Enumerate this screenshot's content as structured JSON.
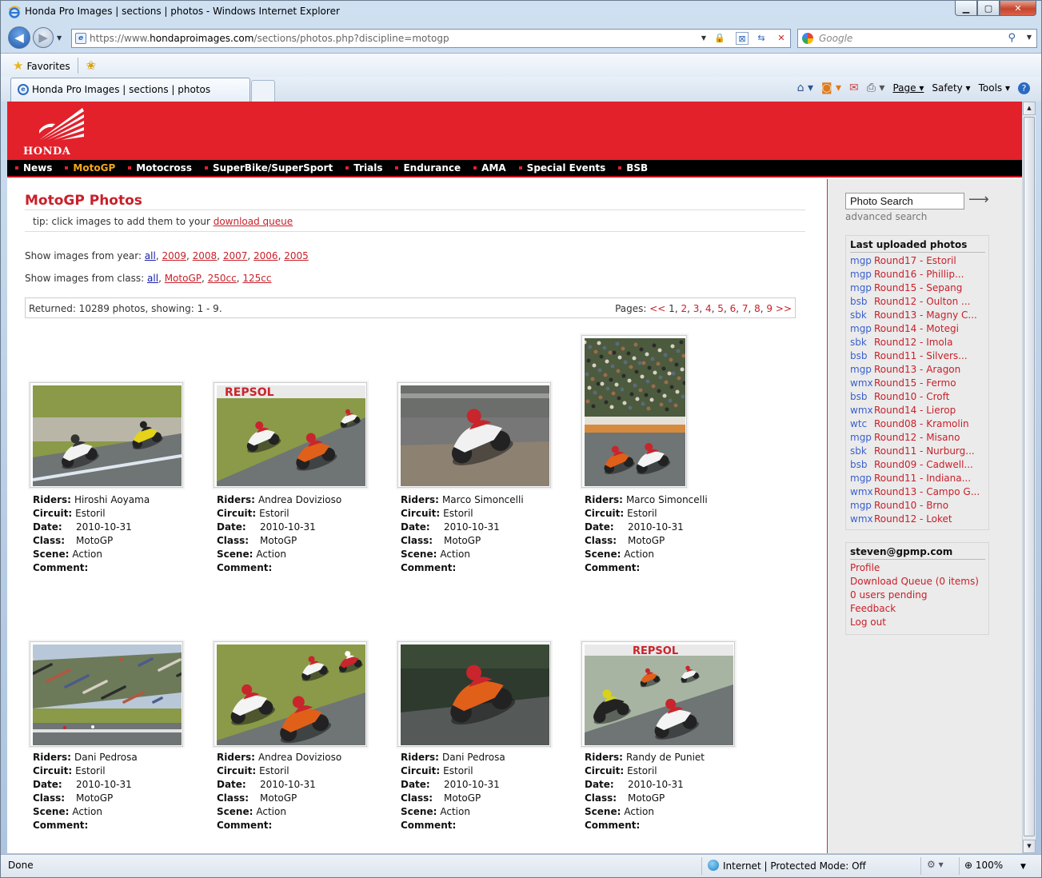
{
  "browser": {
    "window_title": "Honda Pro Images | sections | photos - Windows Internet Explorer",
    "url_prefix": "https://www.",
    "url_domain": "hondaproimages.com",
    "url_path": "/sections/photos.php?discipline=motogp",
    "search_placeholder": "Google",
    "favorites_label": "Favorites",
    "tab_title": "Honda Pro Images | sections | photos",
    "cmd_page": "Page ▾",
    "cmd_safety": "Safety ▾",
    "cmd_tools": "Tools ▾",
    "status_done": "Done",
    "status_zone": "Internet | Protected Mode: Off",
    "status_zoom": "100%"
  },
  "site": {
    "logo_text": "HONDA",
    "nav": [
      "News",
      "MotoGP",
      "Motocross",
      "SuperBike/SuperSport",
      "Trials",
      "Endurance",
      "AMA",
      "Special Events",
      "BSB"
    ],
    "active_nav": "MotoGP",
    "page_title": "MotoGP Photos",
    "tip_text": "tip: click images to add them to your ",
    "tip_link": "download queue",
    "year_label": "Show images from year: ",
    "years": [
      "all",
      "2009",
      "2008",
      "2007",
      "2006",
      "2005"
    ],
    "class_label": "Show images from class: ",
    "classes": [
      "all",
      "MotoGP",
      "250cc",
      "125cc"
    ],
    "returned_text": "Returned: 10289 photos, showing: 1 - 9.",
    "pages_label": "Pages: ",
    "pages": [
      "<<",
      "1",
      "2",
      "3",
      "4",
      "5",
      "6",
      "7",
      "8",
      "9",
      ">>"
    ],
    "labels": {
      "riders": "Riders:",
      "circuit": "Circuit:",
      "date": "Date:",
      "class": "Class:",
      "scene": "Scene:",
      "comment": "Comment:"
    }
  },
  "photos": [
    {
      "riders": "Hiroshi Aoyama",
      "circuit": "Estoril",
      "date": "2010-10-31",
      "class": "MotoGP",
      "scene": "Action",
      "comment": ""
    },
    {
      "riders": "Andrea Dovizioso",
      "circuit": "Estoril",
      "date": "2010-10-31",
      "class": "MotoGP",
      "scene": "Action",
      "comment": ""
    },
    {
      "riders": "Marco Simoncelli",
      "circuit": "Estoril",
      "date": "2010-10-31",
      "class": "MotoGP",
      "scene": "Action",
      "comment": ""
    },
    {
      "riders": "Marco Simoncelli",
      "circuit": "Estoril",
      "date": "2010-10-31",
      "class": "MotoGP",
      "scene": "Action",
      "comment": ""
    },
    {
      "riders": "Dani Pedrosa",
      "circuit": "Estoril",
      "date": "2010-10-31",
      "class": "MotoGP",
      "scene": "Action",
      "comment": ""
    },
    {
      "riders": "Andrea Dovizioso",
      "circuit": "Estoril",
      "date": "2010-10-31",
      "class": "MotoGP",
      "scene": "Action",
      "comment": ""
    },
    {
      "riders": "Dani Pedrosa",
      "circuit": "Estoril",
      "date": "2010-10-31",
      "class": "MotoGP",
      "scene": "Action",
      "comment": ""
    },
    {
      "riders": "Randy de Puniet",
      "circuit": "Estoril",
      "date": "2010-10-31",
      "class": "MotoGP",
      "scene": "Action",
      "comment": ""
    }
  ],
  "sidebar": {
    "search_value": "Photo Search",
    "advanced": "advanced search",
    "last_title": "Last uploaded photos",
    "last": [
      {
        "cat": "mgp",
        "round": "Round17 - Estoril"
      },
      {
        "cat": "mgp",
        "round": "Round16 - Phillip..."
      },
      {
        "cat": "mgp",
        "round": "Round15 - Sepang"
      },
      {
        "cat": "bsb",
        "round": "Round12 - Oulton ..."
      },
      {
        "cat": "sbk",
        "round": "Round13 - Magny C..."
      },
      {
        "cat": "mgp",
        "round": "Round14 - Motegi"
      },
      {
        "cat": "sbk",
        "round": "Round12 - Imola"
      },
      {
        "cat": "bsb",
        "round": "Round11 - Silvers..."
      },
      {
        "cat": "mgp",
        "round": "Round13 - Aragon"
      },
      {
        "cat": "wmx",
        "round": "Round15 - Fermo"
      },
      {
        "cat": "bsb",
        "round": "Round10 - Croft"
      },
      {
        "cat": "wmx",
        "round": "Round14 - Lierop"
      },
      {
        "cat": "wtc",
        "round": "Round08 - Kramolin"
      },
      {
        "cat": "mgp",
        "round": "Round12 - Misano"
      },
      {
        "cat": "sbk",
        "round": "Round11 - Nurburg..."
      },
      {
        "cat": "bsb",
        "round": "Round09 - Cadwell..."
      },
      {
        "cat": "mgp",
        "round": "Round11 - Indiana..."
      },
      {
        "cat": "wmx",
        "round": "Round13 - Campo G..."
      },
      {
        "cat": "mgp",
        "round": "Round10 - Brno"
      },
      {
        "cat": "wmx",
        "round": "Round12 - Loket"
      }
    ],
    "user": "steven@gpmp.com",
    "user_links": [
      "Profile",
      "Download Queue (0 items)",
      "0 users pending",
      "Feedback",
      "Log out"
    ]
  },
  "colors": {
    "brand_red": "#e2212b",
    "link_red": "#c8202a",
    "active_nav": "#f3a71c",
    "category_blue": "#3a5fcd"
  }
}
